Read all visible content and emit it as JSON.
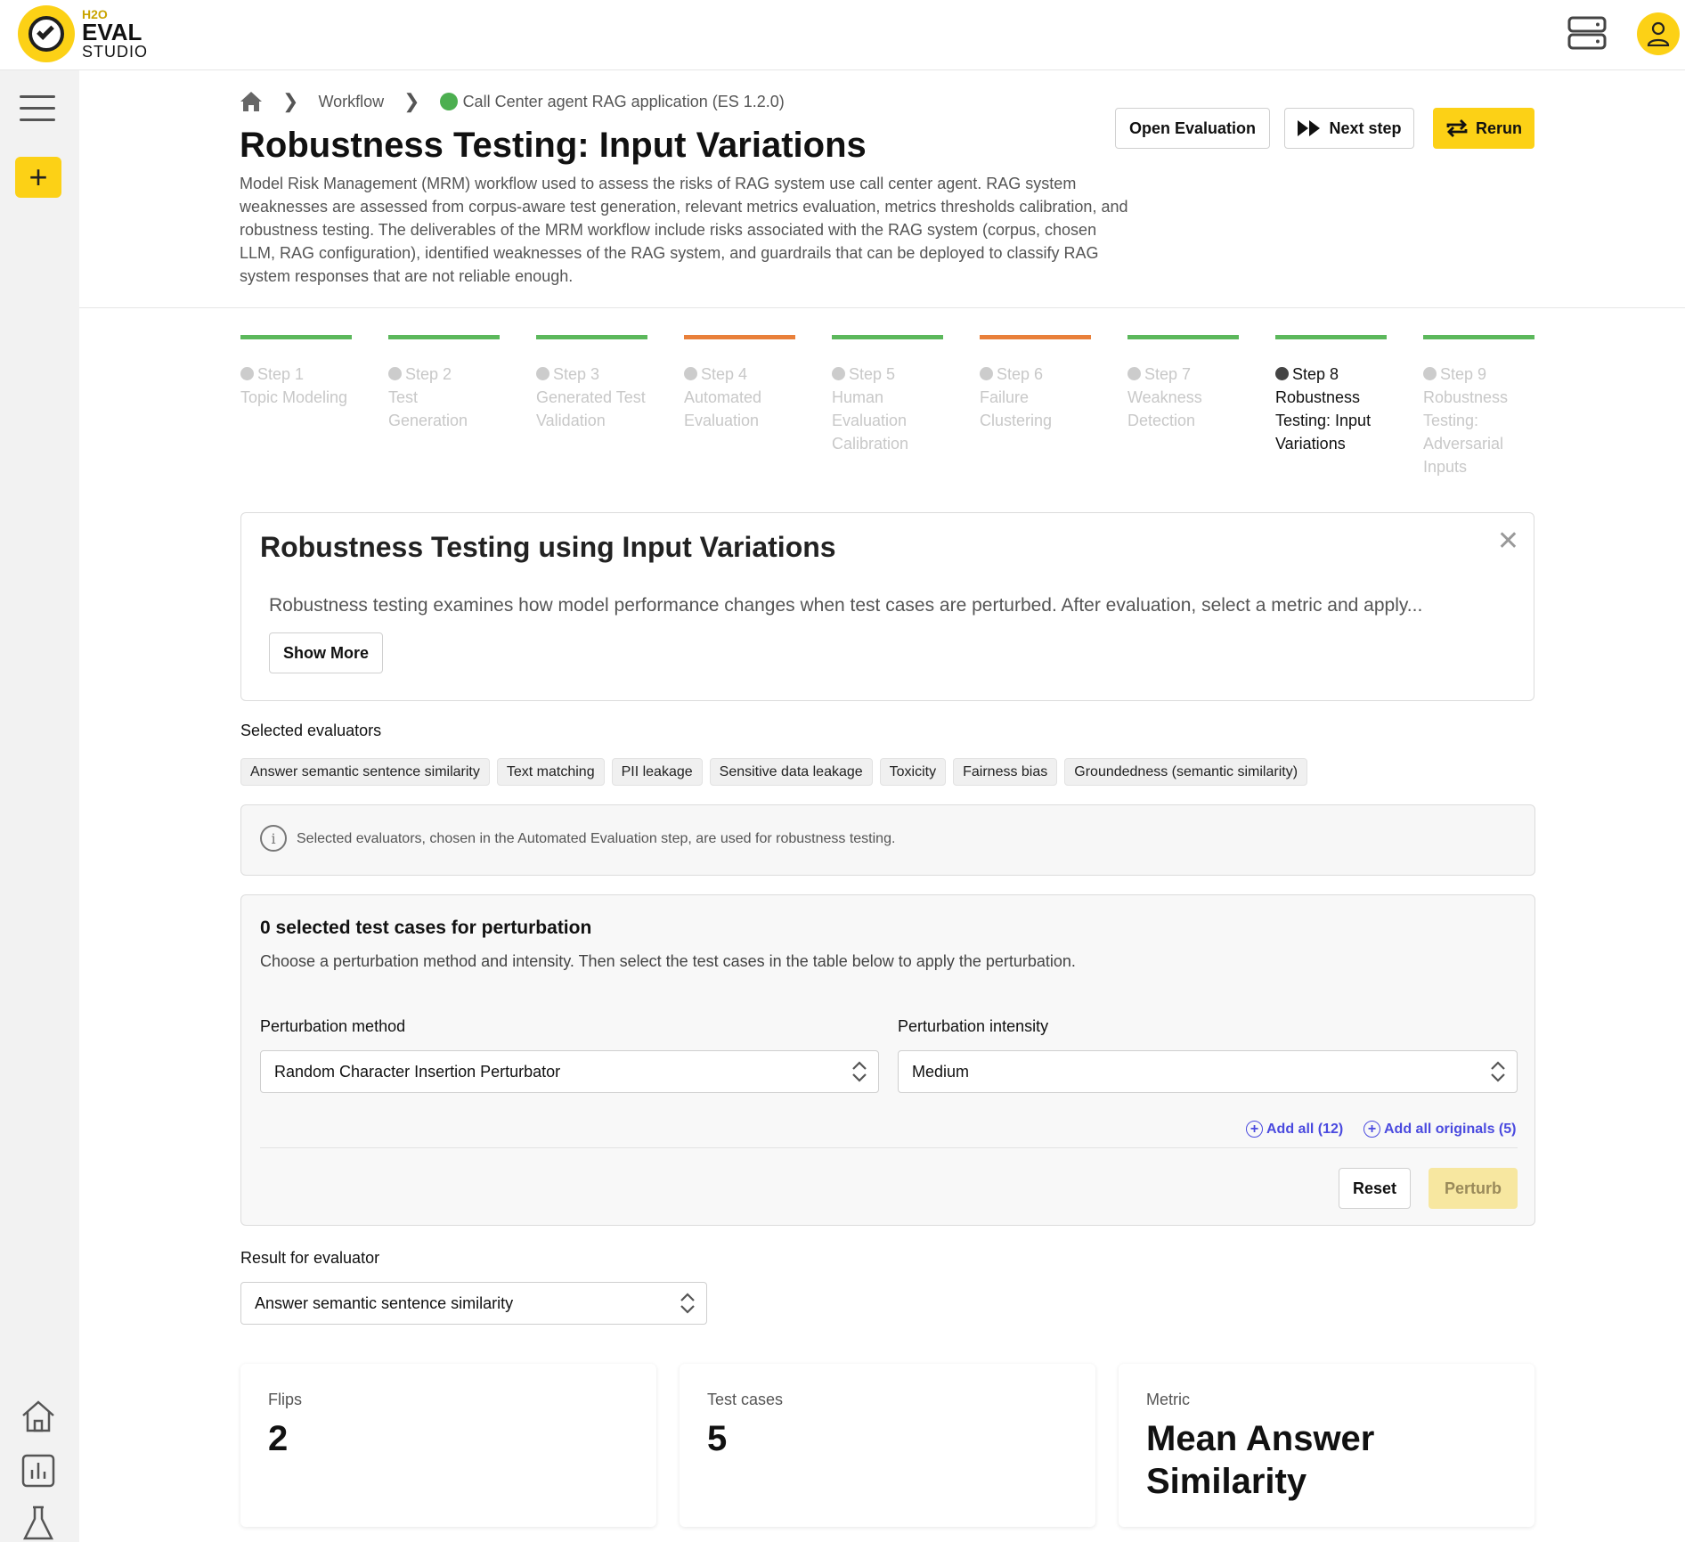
{
  "app": {
    "logo_h2o": "H2O",
    "logo_eval": "EVAL",
    "logo_studio": "STUDIO"
  },
  "breadcrumb": {
    "workflow": "Workflow",
    "current": "Call Center agent RAG application (ES 1.2.0)"
  },
  "header": {
    "title": "Robustness Testing: Input Variations",
    "description": "Model Risk Management (MRM) workflow used to assess the risks of RAG system use call center agent. RAG system weaknesses are assessed from corpus-aware test generation, relevant metrics evaluation, metrics thresholds calibration, and robustness testing. The deliverables of the MRM workflow include risks associated with the RAG system (corpus, chosen LLM, RAG configuration), identified weaknesses of the RAG system, and guardrails that can be deployed to classify RAG system responses that are not reliable enough.",
    "open_evaluation": "Open Evaluation",
    "next_step": "Next step",
    "rerun": "Rerun"
  },
  "steps": [
    {
      "num": "Step 1",
      "name": "Topic Modeling",
      "status": "done"
    },
    {
      "num": "Step 2",
      "name": "Test Generation",
      "status": "done"
    },
    {
      "num": "Step 3",
      "name": "Generated Test Validation",
      "status": "done"
    },
    {
      "num": "Step 4",
      "name": "Automated Evaluation",
      "status": "warning"
    },
    {
      "num": "Step 5",
      "name": "Human Evaluation Calibration",
      "status": "done"
    },
    {
      "num": "Step 6",
      "name": "Failure Clustering",
      "status": "warning"
    },
    {
      "num": "Step 7",
      "name": "Weakness Detection",
      "status": "done"
    },
    {
      "num": "Step 8",
      "name": "Robustness Testing: Input Variations",
      "status": "active"
    },
    {
      "num": "Step 9",
      "name": "Robustness Testing: Adversarial Inputs",
      "status": "done"
    }
  ],
  "info_card": {
    "title": "Robustness Testing using Input Variations",
    "text": "Robustness testing examines how model performance changes when test cases are perturbed. After evaluation, select a metric and apply...",
    "show_more": "Show More"
  },
  "evaluators": {
    "label": "Selected evaluators",
    "chips": [
      "Answer semantic sentence similarity",
      "Text matching",
      "PII leakage",
      "Sensitive data leakage",
      "Toxicity",
      "Fairness bias",
      "Groundedness (semantic similarity)"
    ],
    "note": "Selected evaluators, chosen in the Automated Evaluation step, are used for robustness testing."
  },
  "perturbation": {
    "title": "0 selected test cases for perturbation",
    "description": "Choose a perturbation method and intensity. Then select the test cases in the table below to apply the perturbation.",
    "method_label": "Perturbation method",
    "method_value": "Random Character Insertion Perturbator",
    "intensity_label": "Perturbation intensity",
    "intensity_value": "Medium",
    "add_all": "Add all (12)",
    "add_all_originals": "Add all originals (5)",
    "reset": "Reset",
    "perturb": "Perturb"
  },
  "result": {
    "label": "Result for evaluator",
    "value": "Answer semantic sentence similarity"
  },
  "stats": {
    "flips_label": "Flips",
    "flips_value": "2",
    "test_cases_label": "Test cases",
    "test_cases_value": "5",
    "metric_label": "Metric",
    "metric_value": "Mean Answer Similarity"
  },
  "colors": {
    "accent": "#fcd116",
    "step_done": "#5cb85c",
    "step_warning": "#e9803a",
    "link": "#4a4adf"
  }
}
